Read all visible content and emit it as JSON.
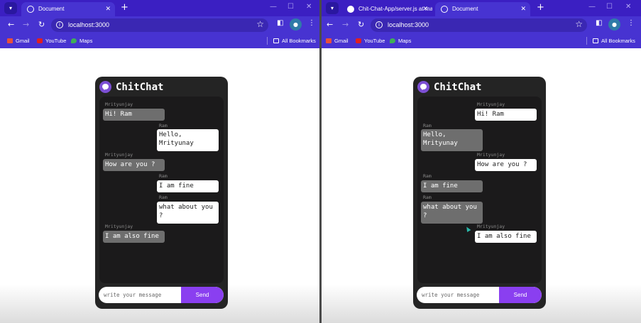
{
  "left_window": {
    "tabs": [
      {
        "title": "Document",
        "active": true
      }
    ],
    "url": "localhost:3000",
    "bookmarks": [
      "Gmail",
      "YouTube",
      "Maps"
    ],
    "all_bookmarks": "All Bookmarks"
  },
  "right_window": {
    "tabs": [
      {
        "title": "Chit-Chat-App/server.js at mai",
        "active": false
      },
      {
        "title": "Document",
        "active": true
      }
    ],
    "url": "localhost:3000",
    "bookmarks": [
      "Gmail",
      "YouTube",
      "Maps"
    ],
    "all_bookmarks": "All Bookmarks"
  },
  "chat": {
    "app_name": "ChitChat",
    "input_placeholder": "write your message",
    "send_label": "Send",
    "colors": {
      "accent": "#8a3ff0",
      "logo": "#7c4fd4",
      "panel": "#242424",
      "incoming": "#6e6e6e",
      "outgoing": "#ffffff"
    }
  },
  "left_chat": {
    "messages": [
      {
        "sender": "Mrityunjay",
        "text": "Hi! Ram",
        "type": "in"
      },
      {
        "sender": "Ram",
        "text": "Hello, Mrityunay",
        "type": "out"
      },
      {
        "sender": "Mrityunjay",
        "text": "How are you ?",
        "type": "in"
      },
      {
        "sender": "Ram",
        "text": "I am fine",
        "type": "out"
      },
      {
        "sender": "Ram",
        "text": "what about you ?",
        "type": "out"
      },
      {
        "sender": "Mrityunjay",
        "text": "I am also fine",
        "type": "in"
      }
    ]
  },
  "right_chat": {
    "messages": [
      {
        "sender": "Mrityunjay",
        "text": "Hi! Ram",
        "type": "out"
      },
      {
        "sender": "Ram",
        "text": "Hello, Mrityunay",
        "type": "in"
      },
      {
        "sender": "Mrityunjay",
        "text": "How are you ?",
        "type": "out"
      },
      {
        "sender": "Ram",
        "text": "I am fine",
        "type": "in"
      },
      {
        "sender": "Ram",
        "text": "what about you ?",
        "type": "in"
      },
      {
        "sender": "Mrityunjay",
        "text": "I am also fine",
        "type": "out"
      }
    ]
  },
  "icons": {
    "tab_menu": "chevron-down-icon",
    "back": "arrow-left-icon",
    "forward": "arrow-right-icon",
    "reload": "reload-icon",
    "site_info": "info-icon",
    "bookmark_star": "star-icon",
    "side_panel": "side-panel-icon",
    "menu": "kebab-menu-icon",
    "logo": "chat-bubble-icon"
  }
}
